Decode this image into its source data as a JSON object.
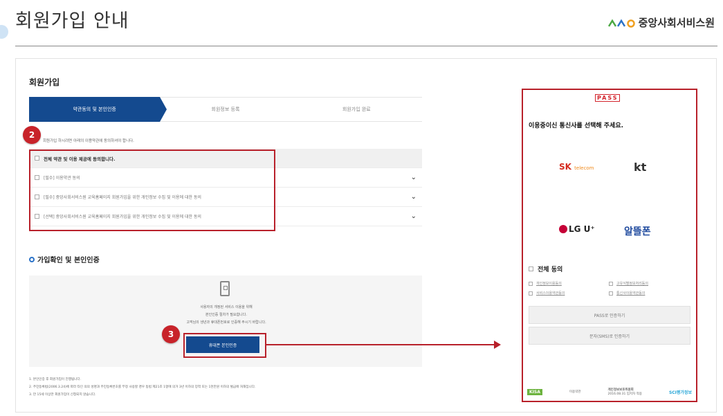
{
  "header": {
    "title": "회원가입 안내",
    "brand_name": "중앙사회서비스원",
    "brand_colors": [
      "#4aa843",
      "#2a72c8",
      "#f0a020"
    ]
  },
  "signup": {
    "section_title": "회원가입",
    "steps": [
      {
        "label": "약관동의 및 본인인증",
        "active": true
      },
      {
        "label": "회원정보 등록",
        "active": false
      },
      {
        "label": "회원가입 완료",
        "active": false
      }
    ],
    "intro": "회원가입 하시려면 아래의 이용약관에 동의하셔야 합니다.",
    "terms": {
      "all_label": "전체 약관 및 이용 제공에 동의합니다.",
      "items": [
        "[필수] 이용약관 동의",
        "[필수] 중앙사회서비스원 교육홈페이지 회원가입을 위한 개인정보 수집 및 이용에 대한 동의",
        "[선택] 중앙사회서비스원 교육홈페이지 회원가입을 위한 개인정보 수집 및 이용에 대한 동의"
      ]
    }
  },
  "verify": {
    "title": "가입확인 및 본인인증",
    "text_lines": [
      "사용자의 개정된 서비스 이용을 위해",
      "본인인증 절차가 필요합니다.",
      "고객님의 생년과 휴대폰번호로 인증해 주시기 바랍니다."
    ],
    "button": "휴대폰 본인인증"
  },
  "notes": [
    "1. 본인인증 후 회원가입이 진행됩니다.",
    "2. 주민등록법(2006.3.24)에 따라 타인 의의 성명과 주민등록번호를 부정 사용할 경우 동법 제21조 1항에 의거 3년 이하의 징역 또는 1천만원 이하의 벌금에 처해집니다.",
    "3. 만 15세 이상만 회원가입이 신청되지 않습니다."
  ],
  "badges": {
    "terms": "2",
    "button": "3"
  },
  "pass": {
    "logo": "PASS",
    "question": "이용중이신 통신사를 선택해 주세요.",
    "carriers": {
      "sk": "SK",
      "sk_sub": "telecom",
      "kt": "kt",
      "lgu": "LG U⁺",
      "mvno": "알뜰폰"
    },
    "all_agree": "전체 동의",
    "agree_items": [
      "개인정보이용동의",
      "고유식별정보처리동의",
      "서비스이용약관동의",
      "통신사이용약관동의"
    ],
    "pass_button": "PASS로 인증하기",
    "sms_button": "문자(SMS)로 인증하기",
    "footer_mid_title": "개인정보보호위원회",
    "footer_left": "이용약관",
    "footer_date": "2016.08.31 입지자 적용",
    "footer_right": "SCI평가정보",
    "footer_kisa": "KISA"
  }
}
